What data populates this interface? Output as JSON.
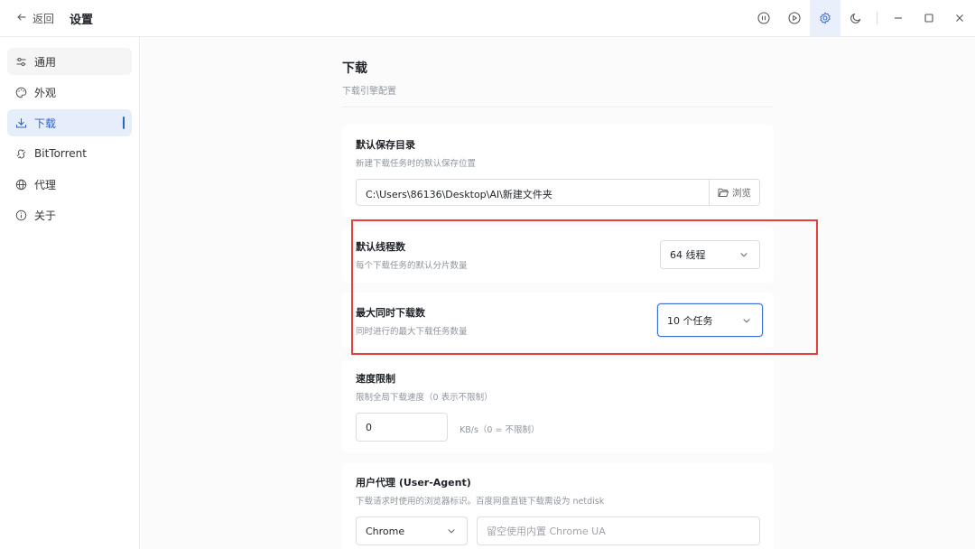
{
  "titlebar": {
    "back_label": "返回",
    "title": "设置",
    "icons": [
      "pause-icon",
      "play-icon",
      "gear-icon",
      "moon-icon",
      "minimize-icon",
      "maximize-icon",
      "close-icon"
    ]
  },
  "sidebar": {
    "items": [
      {
        "label": "通用",
        "icon": "sliders-icon"
      },
      {
        "label": "外观",
        "icon": "palette-icon"
      },
      {
        "label": "下载",
        "icon": "download-icon",
        "active": true
      },
      {
        "label": "BitTorrent",
        "icon": "magnet-icon"
      },
      {
        "label": "代理",
        "icon": "globe-icon"
      },
      {
        "label": "关于",
        "icon": "info-icon"
      }
    ]
  },
  "section": {
    "title": "下载",
    "subtitle": "下载引擎配置"
  },
  "settings": {
    "save_dir": {
      "title": "默认保存目录",
      "desc": "新建下载任务时的默认保存位置",
      "value": "C:\\Users\\86136\\Desktop\\AI\\新建文件夹",
      "browse_label": "浏览"
    },
    "threads": {
      "title": "默认线程数",
      "desc": "每个下载任务的默认分片数量",
      "value": "64 线程"
    },
    "max_downloads": {
      "title": "最大同时下载数",
      "desc": "同时进行的最大下载任务数量",
      "value": "10 个任务"
    },
    "speed_limit": {
      "title": "速度限制",
      "desc": "限制全局下载速度（0 表示不限制）",
      "value": "0",
      "unit": "KB/s（0 = 不限制）"
    },
    "user_agent": {
      "title": "用户代理 (User-Agent)",
      "desc": "下载请求时使用的浏览器标识。百度网盘直链下载需设为 netdisk",
      "select_value": "Chrome",
      "placeholder": "留空使用内置 Chrome UA"
    }
  },
  "colors": {
    "accent": "#2f63c9",
    "highlight": "#e2413e"
  }
}
